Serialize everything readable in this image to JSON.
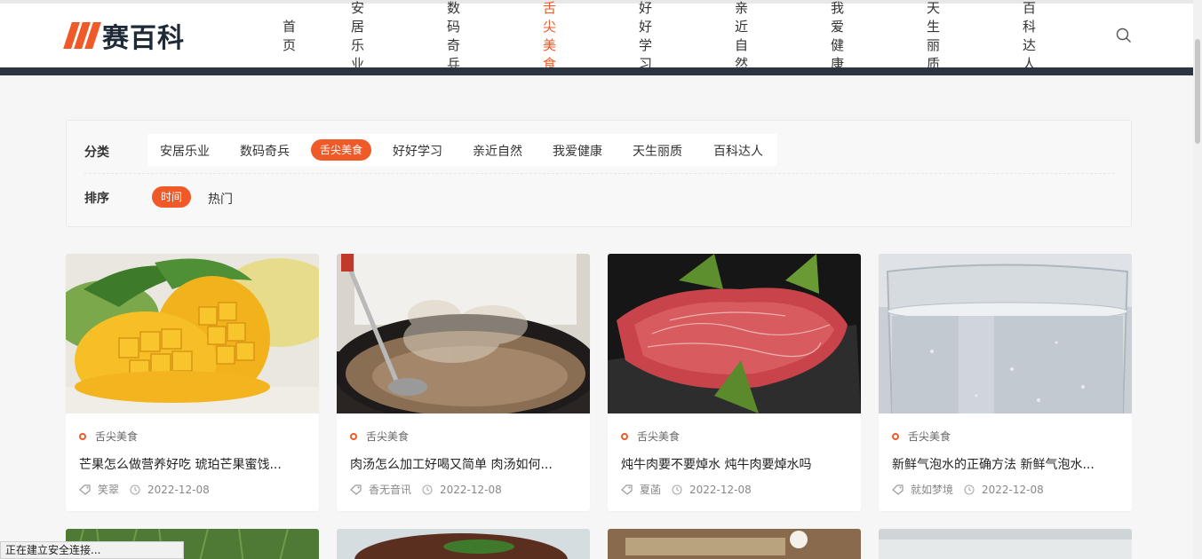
{
  "brand": {
    "name": "赛百科",
    "accent": "#f05a28",
    "dark": "#2c3440"
  },
  "nav": {
    "items": [
      "首页",
      "安居乐业",
      "数码奇兵",
      "舌尖美食",
      "好好学习",
      "亲近自然",
      "我爱健康",
      "天生丽质",
      "百科达人"
    ],
    "active": "舌尖美食",
    "search_icon": "search-icon"
  },
  "filter": {
    "category_label": "分类",
    "categories": [
      "安居乐业",
      "数码奇兵",
      "舌尖美食",
      "好好学习",
      "亲近自然",
      "我爱健康",
      "天生丽质",
      "百科达人"
    ],
    "selected_category": "舌尖美食",
    "sort_label": "排序",
    "sort_options": [
      "时间",
      "热门"
    ],
    "selected_sort": "时间"
  },
  "cards": [
    {
      "category": "舌尖美食",
      "title": "芒果怎么做营养好吃 琥珀芒果蜜饯...",
      "author": "笑翠",
      "date": "2022-12-08",
      "image": "mango"
    },
    {
      "category": "舌尖美食",
      "title": "肉汤怎么加工好喝又简单 肉汤如何...",
      "author": "香无音讯",
      "date": "2022-12-08",
      "image": "soup"
    },
    {
      "category": "舌尖美食",
      "title": "炖牛肉要不要焯水 炖牛肉要焯水吗",
      "author": "夏菡",
      "date": "2022-12-08",
      "image": "beef"
    },
    {
      "category": "舌尖美食",
      "title": "新鲜气泡水的正确方法 新鲜气泡水...",
      "author": "就如梦境",
      "date": "2022-12-08",
      "image": "water"
    }
  ],
  "status_bar": "正在建立安全连接..."
}
